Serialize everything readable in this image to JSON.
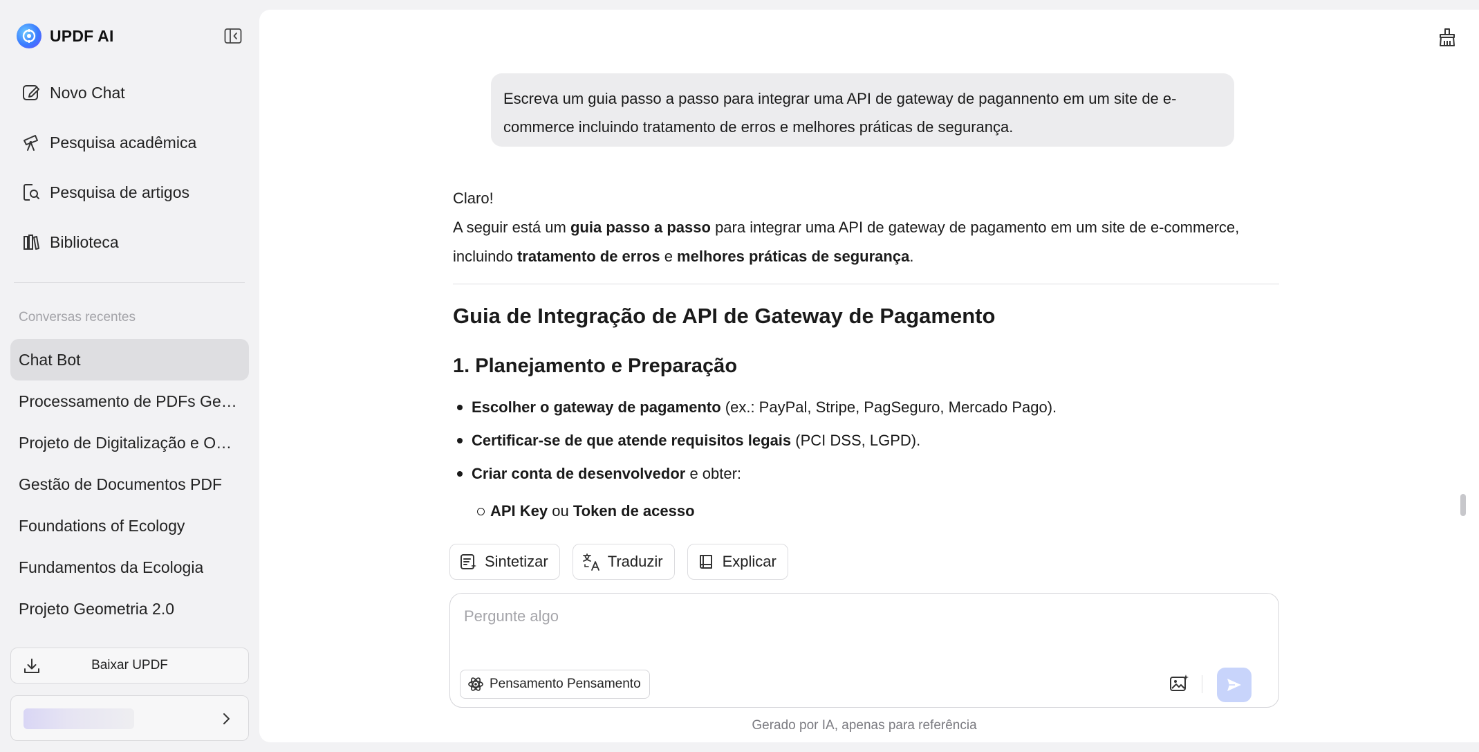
{
  "app": {
    "title": "UPDF AI"
  },
  "sidebar": {
    "nav": [
      {
        "label": "Novo Chat",
        "icon": "edit-icon"
      },
      {
        "label": "Pesquisa acadêmica",
        "icon": "telescope-icon"
      },
      {
        "label": "Pesquisa de artigos",
        "icon": "doc-search-icon"
      },
      {
        "label": "Biblioteca",
        "icon": "library-icon"
      }
    ],
    "recent_title": "Conversas recentes",
    "recent": [
      "Chat Bot",
      "Processamento de PDFs Geo...",
      "Projeto de Digitalização e OC...",
      "Gestão de Documentos PDF",
      "Foundations of Ecology",
      "Fundamentos da Ecologia",
      "Projeto Geometria 2.0"
    ],
    "active_recent": 0,
    "download_label": "Baixar UPDF"
  },
  "chat": {
    "user_message": "Escreva um guia passo a passo para integrar uma API de gateway de pagannento em um site de e-commerce incluindo tratamento de erros e melhores práticas de segurança.",
    "answer": {
      "greeting": "Claro!",
      "intro_1": "A seguir está um ",
      "intro_bold_1": "guia passo a passo",
      "intro_2": " para integrar uma API de gateway de pagamento em um site de e-commerce, incluindo ",
      "intro_bold_2": "tratamento de erros",
      "intro_3": " e ",
      "intro_bold_3": "melhores práticas de segurança",
      "intro_4": ".",
      "heading": "Guia de Integração de API de Gateway de Pagamento",
      "subheading": "1. Planejamento e Preparação",
      "bullets": [
        {
          "bold": "Escolher o gateway de pagamento",
          "text": " (ex.: PayPal, Stripe, PagSeguro, Mercado Pago)."
        },
        {
          "bold": "Certificar-se de que atende requisitos legais",
          "text": " (PCI DSS, LGPD)."
        },
        {
          "bold": "Criar conta de desenvolvedor",
          "text": " e obter:"
        }
      ],
      "sub_bullet": {
        "bold_1": "API Key",
        "mid": " ou ",
        "bold_2": "Token de acesso"
      }
    },
    "actions": [
      {
        "label": "Sintetizar",
        "icon": "summarize-icon"
      },
      {
        "label": "Traduzir",
        "icon": "translate-icon"
      },
      {
        "label": "Explicar",
        "icon": "book-icon"
      }
    ]
  },
  "composer": {
    "placeholder": "Pergunte algo",
    "think_label": "Pensamento Pensamento",
    "footer_note": "Gerado por IA, apenas para referência"
  },
  "colors": {
    "accent": "#3a7bff",
    "send_disabled": "#c8d4fb",
    "active_item": "#dedee1"
  }
}
